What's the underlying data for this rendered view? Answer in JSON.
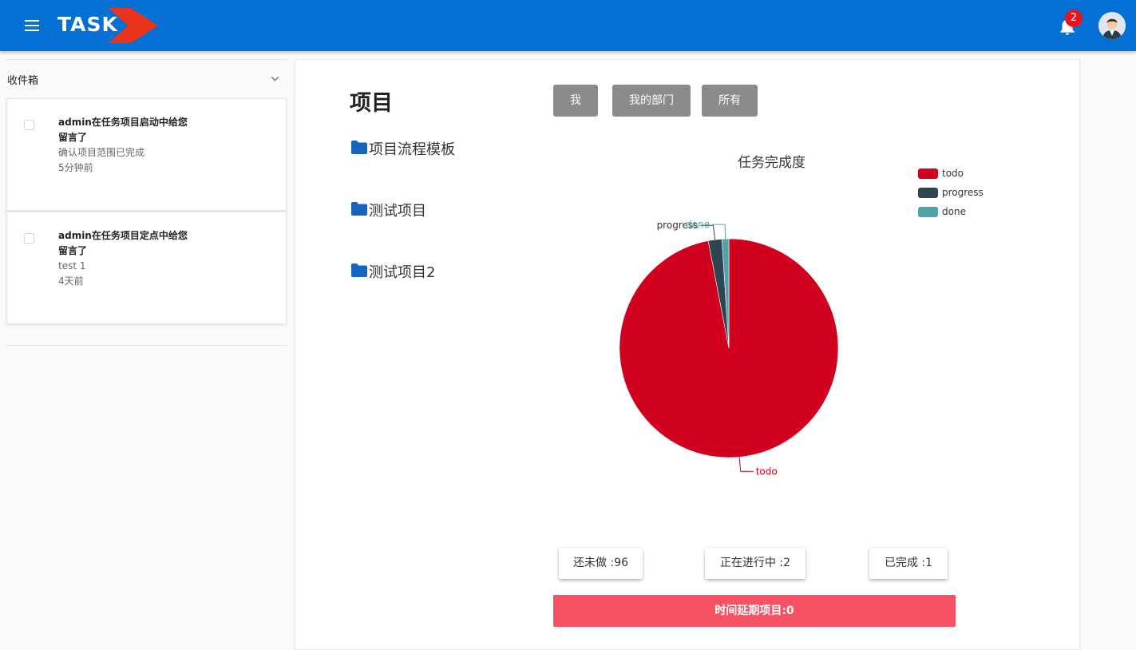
{
  "header": {
    "logo_text": "TASK",
    "notification_count": "2",
    "colors": {
      "bar": "#0470d4",
      "logo_arrow": "#e8341c",
      "badge": "#e8141e"
    }
  },
  "sidebar": {
    "inbox_title": "收件箱",
    "messages": [
      {
        "title": "admin在任务项目启动中给您留言了",
        "body": "确认项目范围已完成",
        "time": "5分钟前"
      },
      {
        "title": "admin在任务项目定点中给您留言了",
        "body": "test 1",
        "time": "4天前"
      }
    ]
  },
  "main": {
    "title": "项目",
    "projects": [
      "项目流程模板",
      "测试项目",
      "测试项目2"
    ],
    "filters": [
      "我",
      "我的部门",
      "所有"
    ],
    "stats": {
      "todo_label": "还未做 :96",
      "progress_label": "正在进行中 :2",
      "done_label": "已完成 :1",
      "delay_label": "时间延期项目:0"
    }
  },
  "chart_data": {
    "type": "pie",
    "title": "任务完成度",
    "legend_position": "top-right",
    "slices": [
      {
        "name": "todo",
        "value": 96,
        "color": "#d0001e"
      },
      {
        "name": "progress",
        "value": 2,
        "color": "#2f4553"
      },
      {
        "name": "done",
        "value": 1,
        "color": "#50a3a8"
      }
    ]
  }
}
